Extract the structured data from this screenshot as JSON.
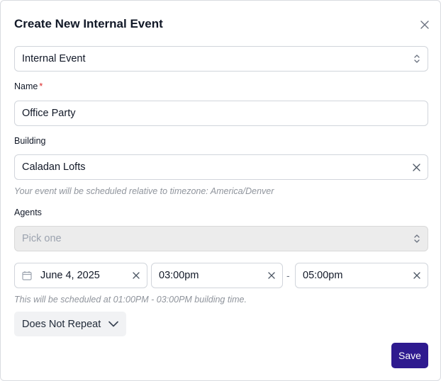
{
  "dialog": {
    "title": "Create New Internal Event"
  },
  "event_type": {
    "value": "Internal Event"
  },
  "name": {
    "label": "Name",
    "required_marker": "*",
    "value": "Office Party"
  },
  "building": {
    "label": "Building",
    "value": "Caladan Lofts",
    "hint": "Your event will be scheduled relative to timezone: America/Denver"
  },
  "agents": {
    "label": "Agents",
    "placeholder": "Pick one"
  },
  "schedule": {
    "date": "June 4, 2025",
    "start_time": "03:00pm",
    "separator": "-",
    "end_time": "05:00pm",
    "hint": "This will be scheduled at 01:00PM - 03:00PM building time."
  },
  "repeat": {
    "value": "Does Not Repeat"
  },
  "actions": {
    "save_label": "Save"
  },
  "icons": {
    "close": "close-icon",
    "select": "chevron-up-down-icon",
    "clear": "clear-x-icon",
    "calendar": "calendar-icon",
    "dropdown": "chevron-down-icon"
  }
}
